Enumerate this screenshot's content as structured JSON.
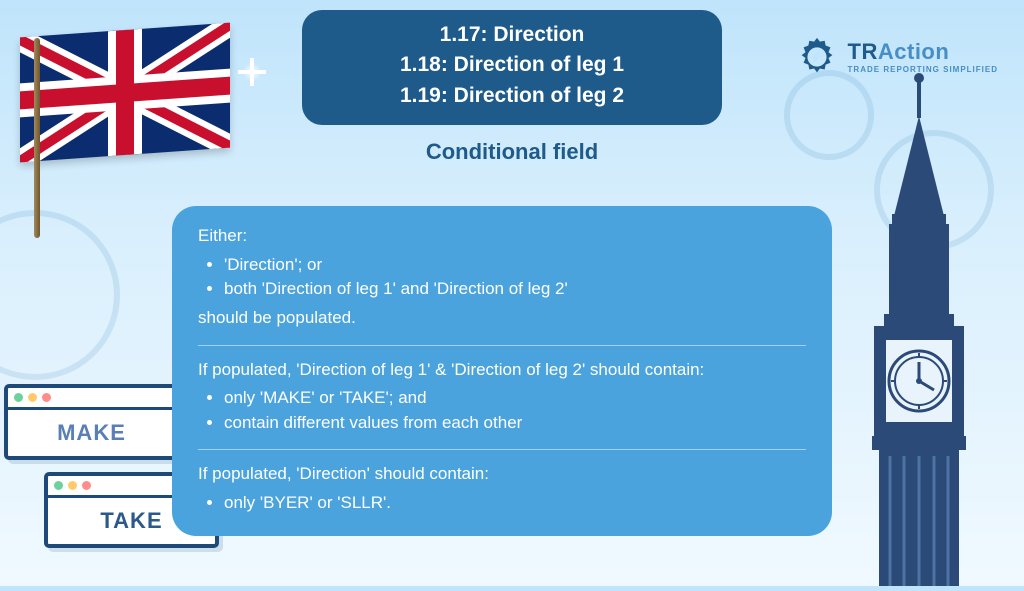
{
  "title": {
    "l1": "1.17: Direction",
    "l2": "1.18: Direction of leg 1",
    "l3": "1.19: Direction of leg 2"
  },
  "logo": {
    "name_a": "TR",
    "name_b": "Action",
    "tagline": "TRADE REPORTING SIMPLIFIED"
  },
  "heading": "Conditional field",
  "card": {
    "s1_intro": "Either:",
    "s1_b1": "'Direction'; or",
    "s1_b2": "both 'Direction of leg 1' and 'Direction of leg 2'",
    "s1_outro": "should be populated.",
    "s2_intro": "If populated, 'Direction of leg 1' & 'Direction of leg 2' should contain:",
    "s2_b1": "only 'MAKE' or 'TAKE'; and",
    "s2_b2": "contain different values from each other",
    "s3_intro": "If populated, 'Direction' should contain:",
    "s3_b1": "only 'BYER' or 'SLLR'."
  },
  "windows": {
    "make": "MAKE",
    "take": "TAKE"
  }
}
